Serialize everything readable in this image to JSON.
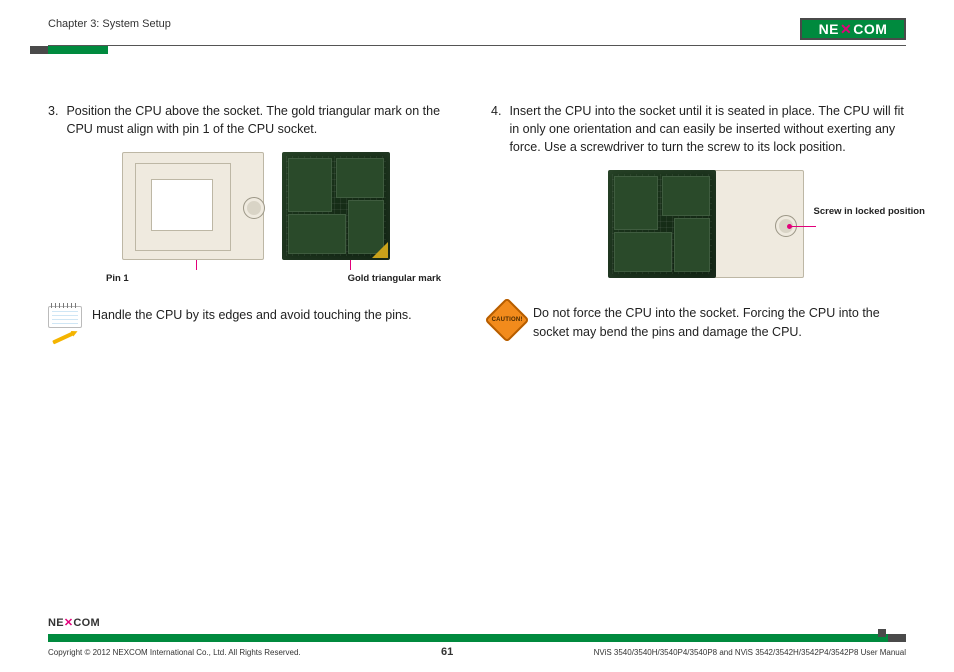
{
  "header": {
    "chapter": "Chapter 3: System Setup",
    "logo_text": "NE COM",
    "logo_x": "✕"
  },
  "left": {
    "step_num": "3.",
    "step_text": "Position the CPU above the socket. The gold triangular mark on the CPU must align with pin 1 of the CPU socket.",
    "pin1_label": "Pin 1",
    "gold_label": "Gold triangular mark",
    "note_text": "Handle the CPU by its edges and avoid touching the pins."
  },
  "right": {
    "step_num": "4.",
    "step_text": "Insert the CPU into the socket until it is seated in place. The CPU will fit in only one orientation and can easily be inserted without exerting any force. Use a screwdriver to turn the screw to its lock position.",
    "callout": "Screw in locked position",
    "caution_badge": "CAUTION!",
    "caution_text": "Do not force the CPU into the socket. Forcing the CPU into the socket may bend the pins and damage the CPU."
  },
  "footer": {
    "logo_pre": "NE",
    "logo_x": "✕",
    "logo_post": "COM",
    "copyright": "Copyright © 2012 NEXCOM International Co., Ltd. All Rights Reserved.",
    "page": "61",
    "doc": "NViS 3540/3540H/3540P4/3540P8 and NViS 3542/3542H/3542P4/3542P8 User Manual"
  }
}
